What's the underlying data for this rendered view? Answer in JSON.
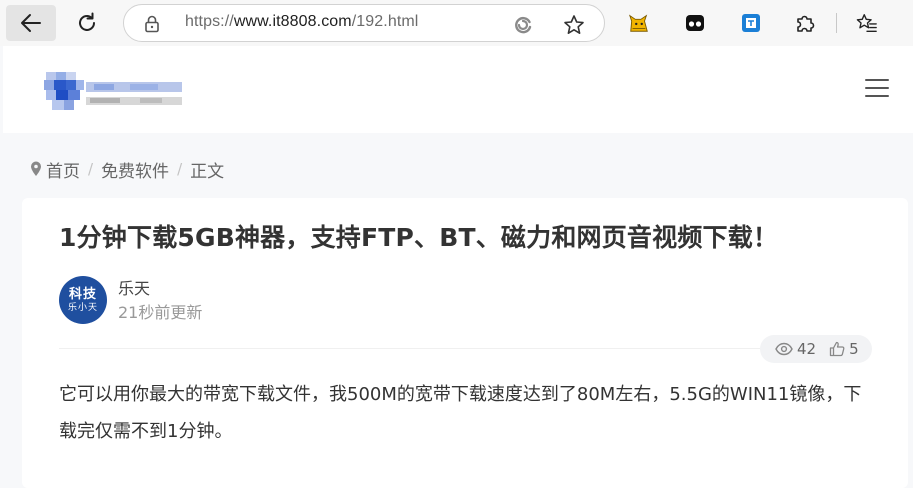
{
  "browser": {
    "url_prefix": "https://",
    "url_domain": "www.it8808.com",
    "url_path": "/192.html",
    "icons": [
      "back-arrow-icon",
      "reload-icon",
      "lock-icon",
      "edge-refresh-icon",
      "favorite-star-icon",
      "cat-extension-icon",
      "mask-extension-icon",
      "translate-extension-icon",
      "puzzle-extensions-icon",
      "favorites-list-icon"
    ]
  },
  "header": {
    "menu_icon": "hamburger-menu-icon"
  },
  "breadcrumb": {
    "home": "首页",
    "category": "免费软件",
    "current": "正文",
    "separator": "/"
  },
  "article": {
    "title": "1分钟下载5GB神器，支持FTP、BT、磁力和网页音视频下载！",
    "author": {
      "avatar_line1": "科技",
      "avatar_line2": "乐小天",
      "name": "乐天",
      "time": "21秒前更新"
    },
    "stats": {
      "views": "42",
      "likes": "5"
    },
    "content": "它可以用你最大的带宽下载文件，我500M的宽带下载速度达到了80M左右，5.5G的WIN11镜像，下载完仅需不到1分钟。"
  },
  "colors": {
    "avatar_bg": "#1f4f9f",
    "title": "#333333",
    "muted": "#999999"
  }
}
